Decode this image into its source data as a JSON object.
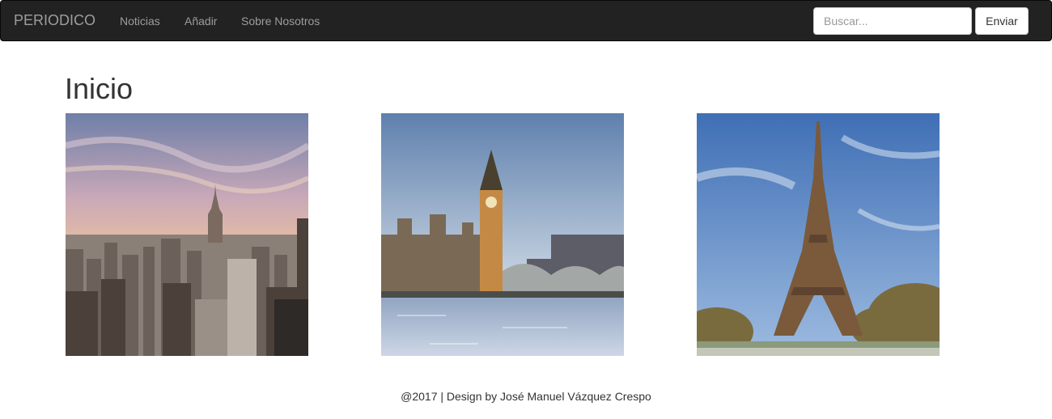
{
  "navbar": {
    "brand": "PERIODICO",
    "links": [
      "Noticias",
      "Añadir",
      "Sobre Nosotros"
    ],
    "search_placeholder": "Buscar...",
    "submit_label": "Enviar"
  },
  "main": {
    "title": "Inicio",
    "photos": [
      {
        "icon": "new-york-skyline-photo"
      },
      {
        "icon": "big-ben-london-photo"
      },
      {
        "icon": "eiffel-tower-paris-photo"
      }
    ]
  },
  "footer": {
    "text": "@2017 | Design by José Manuel Vázquez Crespo"
  },
  "colors": {
    "navbar_bg": "#222222",
    "nav_text": "#9d9d9d"
  }
}
